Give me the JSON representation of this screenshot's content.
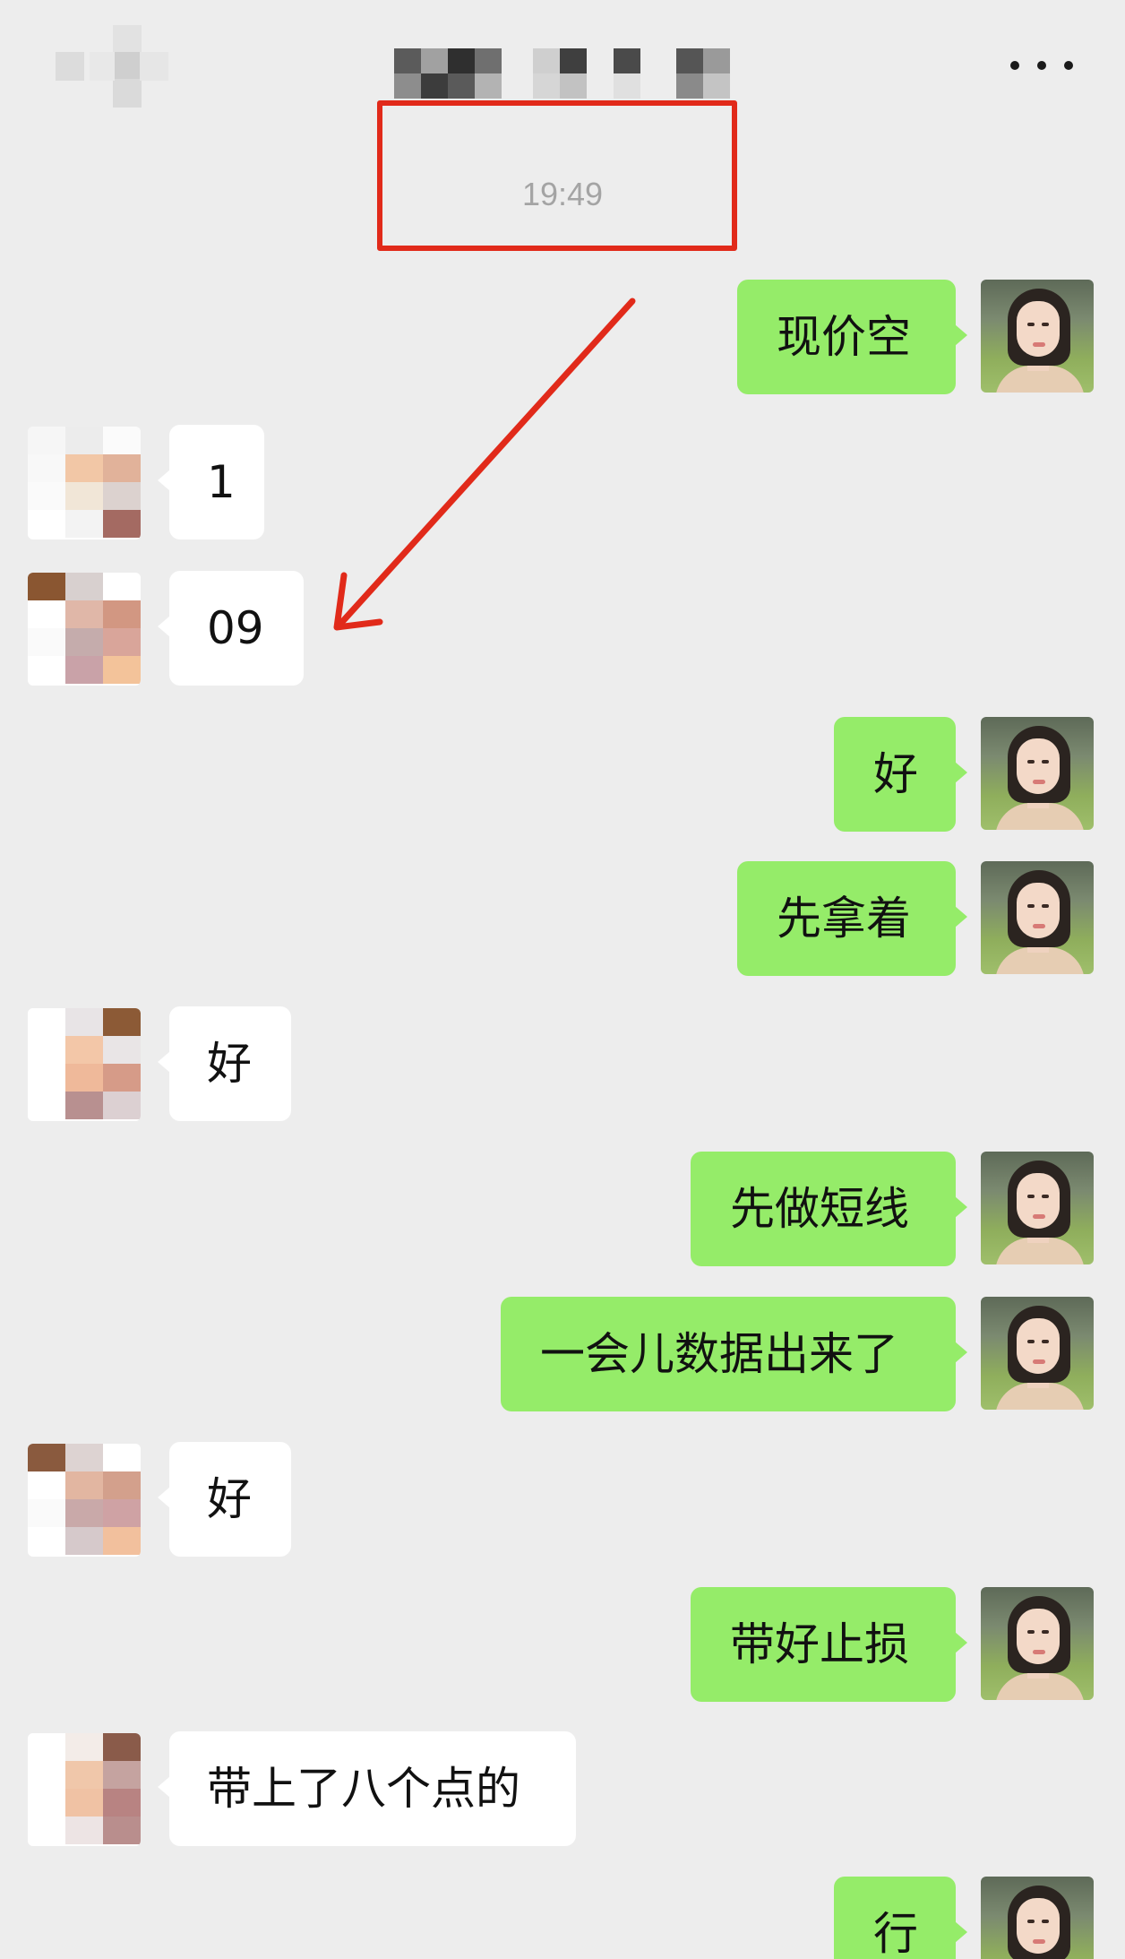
{
  "header": {
    "more_icon": "more-dots-icon"
  },
  "timestamp": "19:49",
  "colors": {
    "background": "#ededed",
    "outgoing_bubble": "#95ec69",
    "incoming_bubble": "#ffffff",
    "annotation_red": "#e12a1a"
  },
  "messages": [
    {
      "side": "out",
      "text": "现价空"
    },
    {
      "side": "in",
      "text": "1"
    },
    {
      "side": "in",
      "text": "09"
    },
    {
      "side": "out",
      "text": "好"
    },
    {
      "side": "out",
      "text": "先拿着"
    },
    {
      "side": "in",
      "text": "好"
    },
    {
      "side": "out",
      "text": "先做短线"
    },
    {
      "side": "out",
      "text": "一会儿数据出来了"
    },
    {
      "side": "in",
      "text": "好"
    },
    {
      "side": "out",
      "text": "带好止损"
    },
    {
      "side": "in",
      "text": "带上了八个点的"
    },
    {
      "side": "out",
      "text": "行"
    }
  ]
}
